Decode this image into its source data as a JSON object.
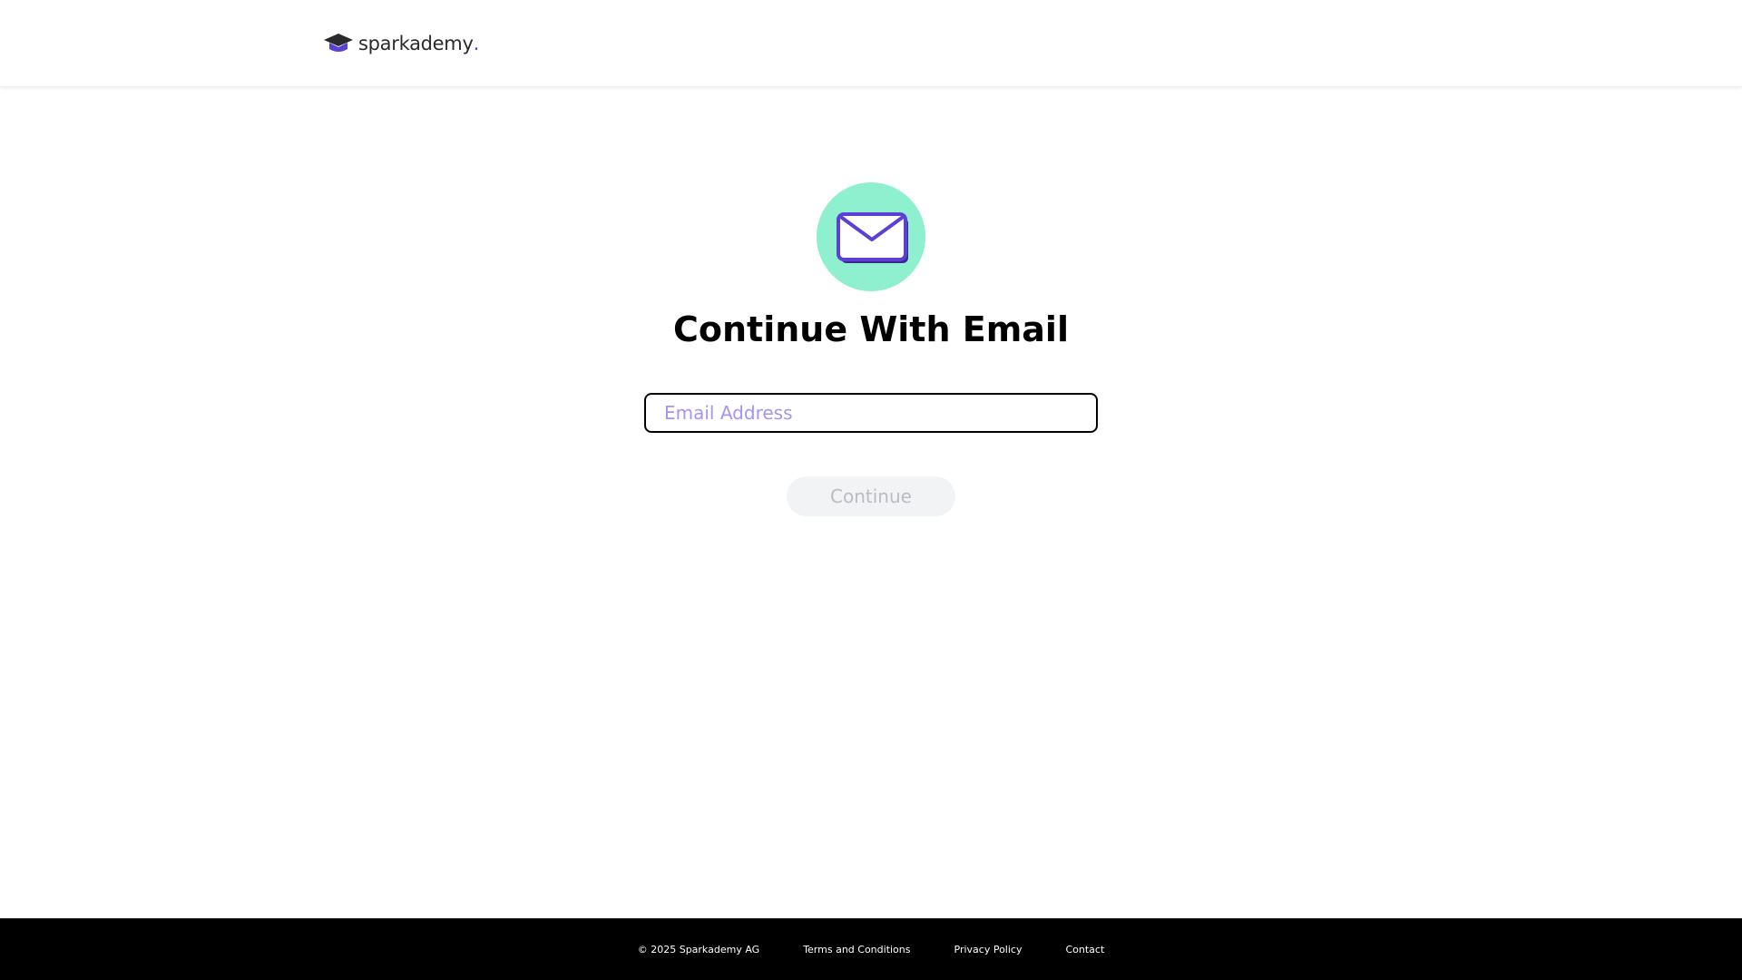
{
  "header": {
    "logo_text": "sparkademy",
    "logo_dot": ".",
    "logo_icon": "graduation-cap-icon",
    "logo_colors": {
      "cap_top": "#2a2a2a",
      "cap_base": "#5b3fd6"
    }
  },
  "main": {
    "icon": "envelope-icon",
    "icon_circle_color": "#8ef0cf",
    "icon_color": "#5b3fd6",
    "title": "Continue With Email",
    "email_input": {
      "placeholder": "Email Address",
      "value": ""
    },
    "continue_label": "Continue",
    "continue_disabled": true
  },
  "footer": {
    "copyright": "© 2025 Sparkademy AG",
    "links": [
      {
        "label": "Terms and Conditions"
      },
      {
        "label": "Privacy Policy"
      },
      {
        "label": "Contact"
      }
    ]
  }
}
